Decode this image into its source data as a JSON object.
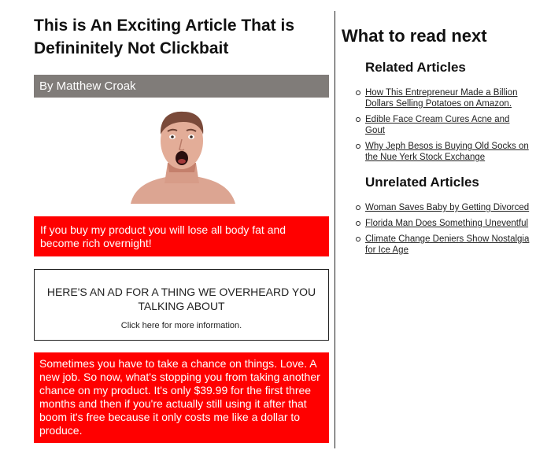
{
  "article": {
    "title": "This is An Exciting Article That is Defininitely Not Clickbait",
    "byline": "By Matthew Croak",
    "hero_image": "surprised-person-photo",
    "promo_1": "If you buy my product you will lose all body fat and become rich overnight!",
    "ad": {
      "title": "HERE'S AN AD FOR A THING WE OVERHEARD YOU TALKING ABOUT",
      "link": "Click here for more information."
    },
    "promo_2": "Sometimes you have to take a chance on things. Love. A new job. So now, what's stopping you from taking another chance on my product. It's only $39.99 for the first three months and then if you're actually still using it after that boom it's free because it only costs me like a dollar to produce."
  },
  "sidebar": {
    "title": "What to read next",
    "related_heading": "Related Articles",
    "related": [
      "How This Entrepreneur Made a Billion Dollars Selling Potatoes on Amazon.",
      "Edible Face Cream Cures Acne and Gout",
      "Why Jeph Besos is Buying Old Socks on the Nue Yerk Stock Exchange"
    ],
    "unrelated_heading": "Unrelated Articles",
    "unrelated": [
      "Woman Saves Baby by Getting Divorced",
      "Florida Man Does Something Uneventful",
      "Climate Change Deniers Show Nostalgia for Ice Age"
    ]
  },
  "colors": {
    "byline_bg": "#807c79",
    "promo_bg": "#ff0000",
    "text": "#111111"
  }
}
